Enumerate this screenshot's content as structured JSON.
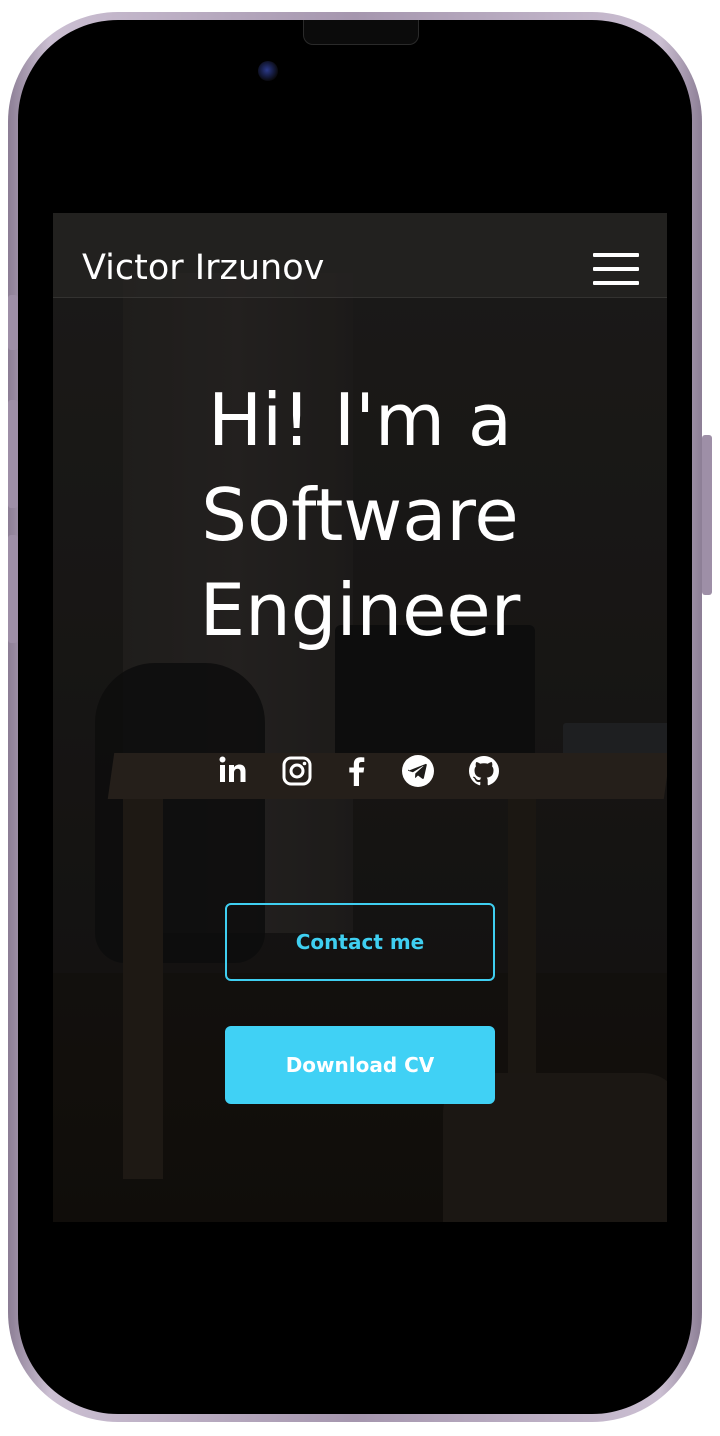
{
  "header": {
    "brand_name": "Victor Irzunov",
    "menu_icon": "hamburger-menu-icon"
  },
  "hero": {
    "title_line1": "Hi! I'm a",
    "title_line2": "Software",
    "title_line3": "Engineer"
  },
  "socials": [
    {
      "name": "linkedin",
      "icon": "linkedin-icon"
    },
    {
      "name": "instagram",
      "icon": "instagram-icon"
    },
    {
      "name": "facebook",
      "icon": "facebook-icon"
    },
    {
      "name": "telegram",
      "icon": "telegram-icon"
    },
    {
      "name": "github",
      "icon": "github-icon"
    }
  ],
  "actions": {
    "contact_label": "Contact me",
    "download_label": "Download CV"
  },
  "colors": {
    "accent": "#40d1f5",
    "text": "#ffffff",
    "phone_frame": "#a596ae"
  }
}
